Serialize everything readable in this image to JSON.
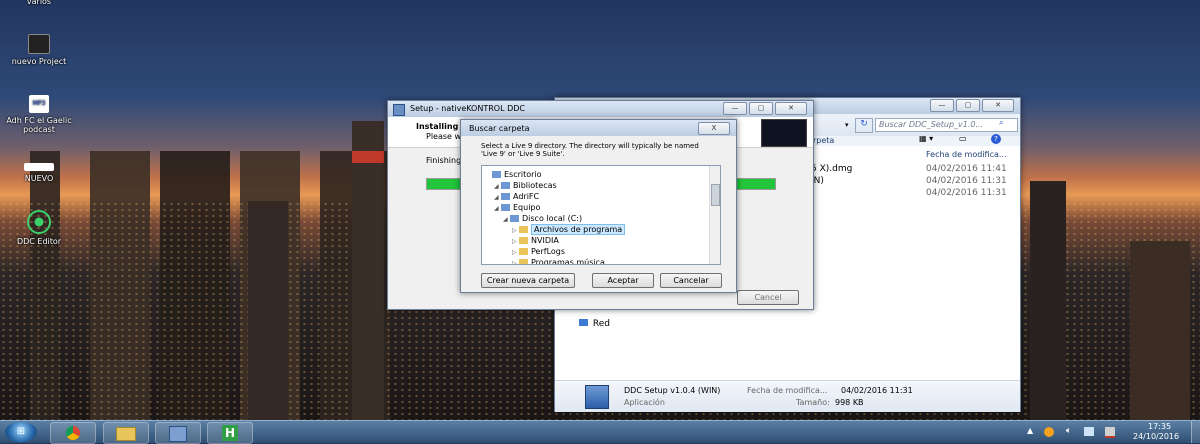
{
  "desktop": {
    "icons": [
      {
        "label": "varios"
      },
      {
        "label": "nuevo Project"
      },
      {
        "label": "Adh FC el Gaelic podcast"
      },
      {
        "label": "NUEVO"
      },
      {
        "label": "DDC Editor"
      }
    ]
  },
  "explorer": {
    "search_placeholder": "Buscar DDC_Setup_v1.0...",
    "column_partial": "rpeta",
    "column_date": "Fecha de modifica...",
    "rows": [
      {
        "name": "5 X).dmg",
        "date": "04/02/2016 11:41"
      },
      {
        "name": "IN)",
        "date": "04/02/2016 11:31"
      },
      {
        "name": "",
        "date": "04/02/2016 11:31"
      }
    ],
    "sidebar_red": "Red",
    "details": {
      "name": "DDC Setup v1.0.4 (WIN)",
      "type": "Aplicación",
      "date_label": "Fecha de modifica...",
      "date_value": "04/02/2016 11:31",
      "size_label": "Tamaño:",
      "size_value": "998 KB"
    }
  },
  "setup": {
    "title": "Setup - nativeKONTROL DDC",
    "installing": "Installing",
    "please": "Please w",
    "finishing": "Finishing",
    "progress": 1.0,
    "cancel_label": "Cancel"
  },
  "folder_dialog": {
    "title": "Buscar carpeta",
    "instruction": "Select a Live 9 directory. The directory will typically be named 'Live 9' or 'Live 9 Suite'.",
    "tree": [
      {
        "label": "Escritorio",
        "indent": 0
      },
      {
        "label": "Bibliotecas",
        "indent": 1
      },
      {
        "label": "AdriFC",
        "indent": 1
      },
      {
        "label": "Equipo",
        "indent": 1
      },
      {
        "label": "Disco local (C:)",
        "indent": 2
      },
      {
        "label": "Archivos de programa",
        "indent": 3,
        "selected": true
      },
      {
        "label": "NVIDIA",
        "indent": 3
      },
      {
        "label": "PerfLogs",
        "indent": 3
      },
      {
        "label": "Programas música",
        "indent": 3
      }
    ],
    "buttons": {
      "new_folder": "Crear nueva carpeta",
      "accept": "Aceptar",
      "cancel": "Cancelar"
    },
    "close_label": "X"
  },
  "taskbar": {
    "time": "17:35",
    "date": "24/10/2016"
  },
  "colors": {
    "accent": "#3399ff",
    "progress": "#22c43a",
    "title_blue": "#1f3f73"
  }
}
